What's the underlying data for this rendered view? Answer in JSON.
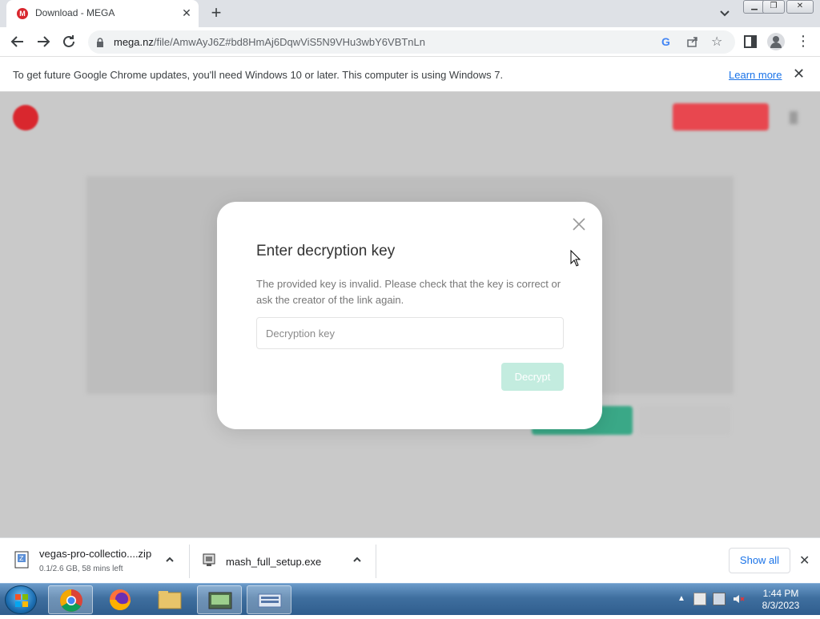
{
  "browser": {
    "tab": {
      "title": "Download - MEGA",
      "favicon": "M"
    },
    "url": {
      "host": "mega.nz",
      "path": "/file/AmwAyJ6Z#bd8HmAj6DqwViS5N9VHu3wbY6VBTnLn"
    }
  },
  "infobar": {
    "message": "To get future Google Chrome updates, you'll need Windows 10 or later. This computer is using Windows 7.",
    "link": "Learn more"
  },
  "modal": {
    "title": "Enter decryption key",
    "description": "The provided key is invalid. Please check that the key is correct or ask the creator of the link again.",
    "input_placeholder": "Decryption key",
    "input_value": "",
    "button": "Decrypt",
    "accent": "#c3ecdf"
  },
  "downloads": [
    {
      "name": "vegas-pro-collectio....zip",
      "status": "0.1/2.6 GB, 58 mins left",
      "icon": "zip-file-icon"
    },
    {
      "name": "mash_full_setup.exe",
      "status": "",
      "icon": "exe-file-icon"
    }
  ],
  "shelf": {
    "show_all": "Show all"
  },
  "taskbar": {
    "time": "1:44 PM",
    "date": "8/3/2023"
  }
}
